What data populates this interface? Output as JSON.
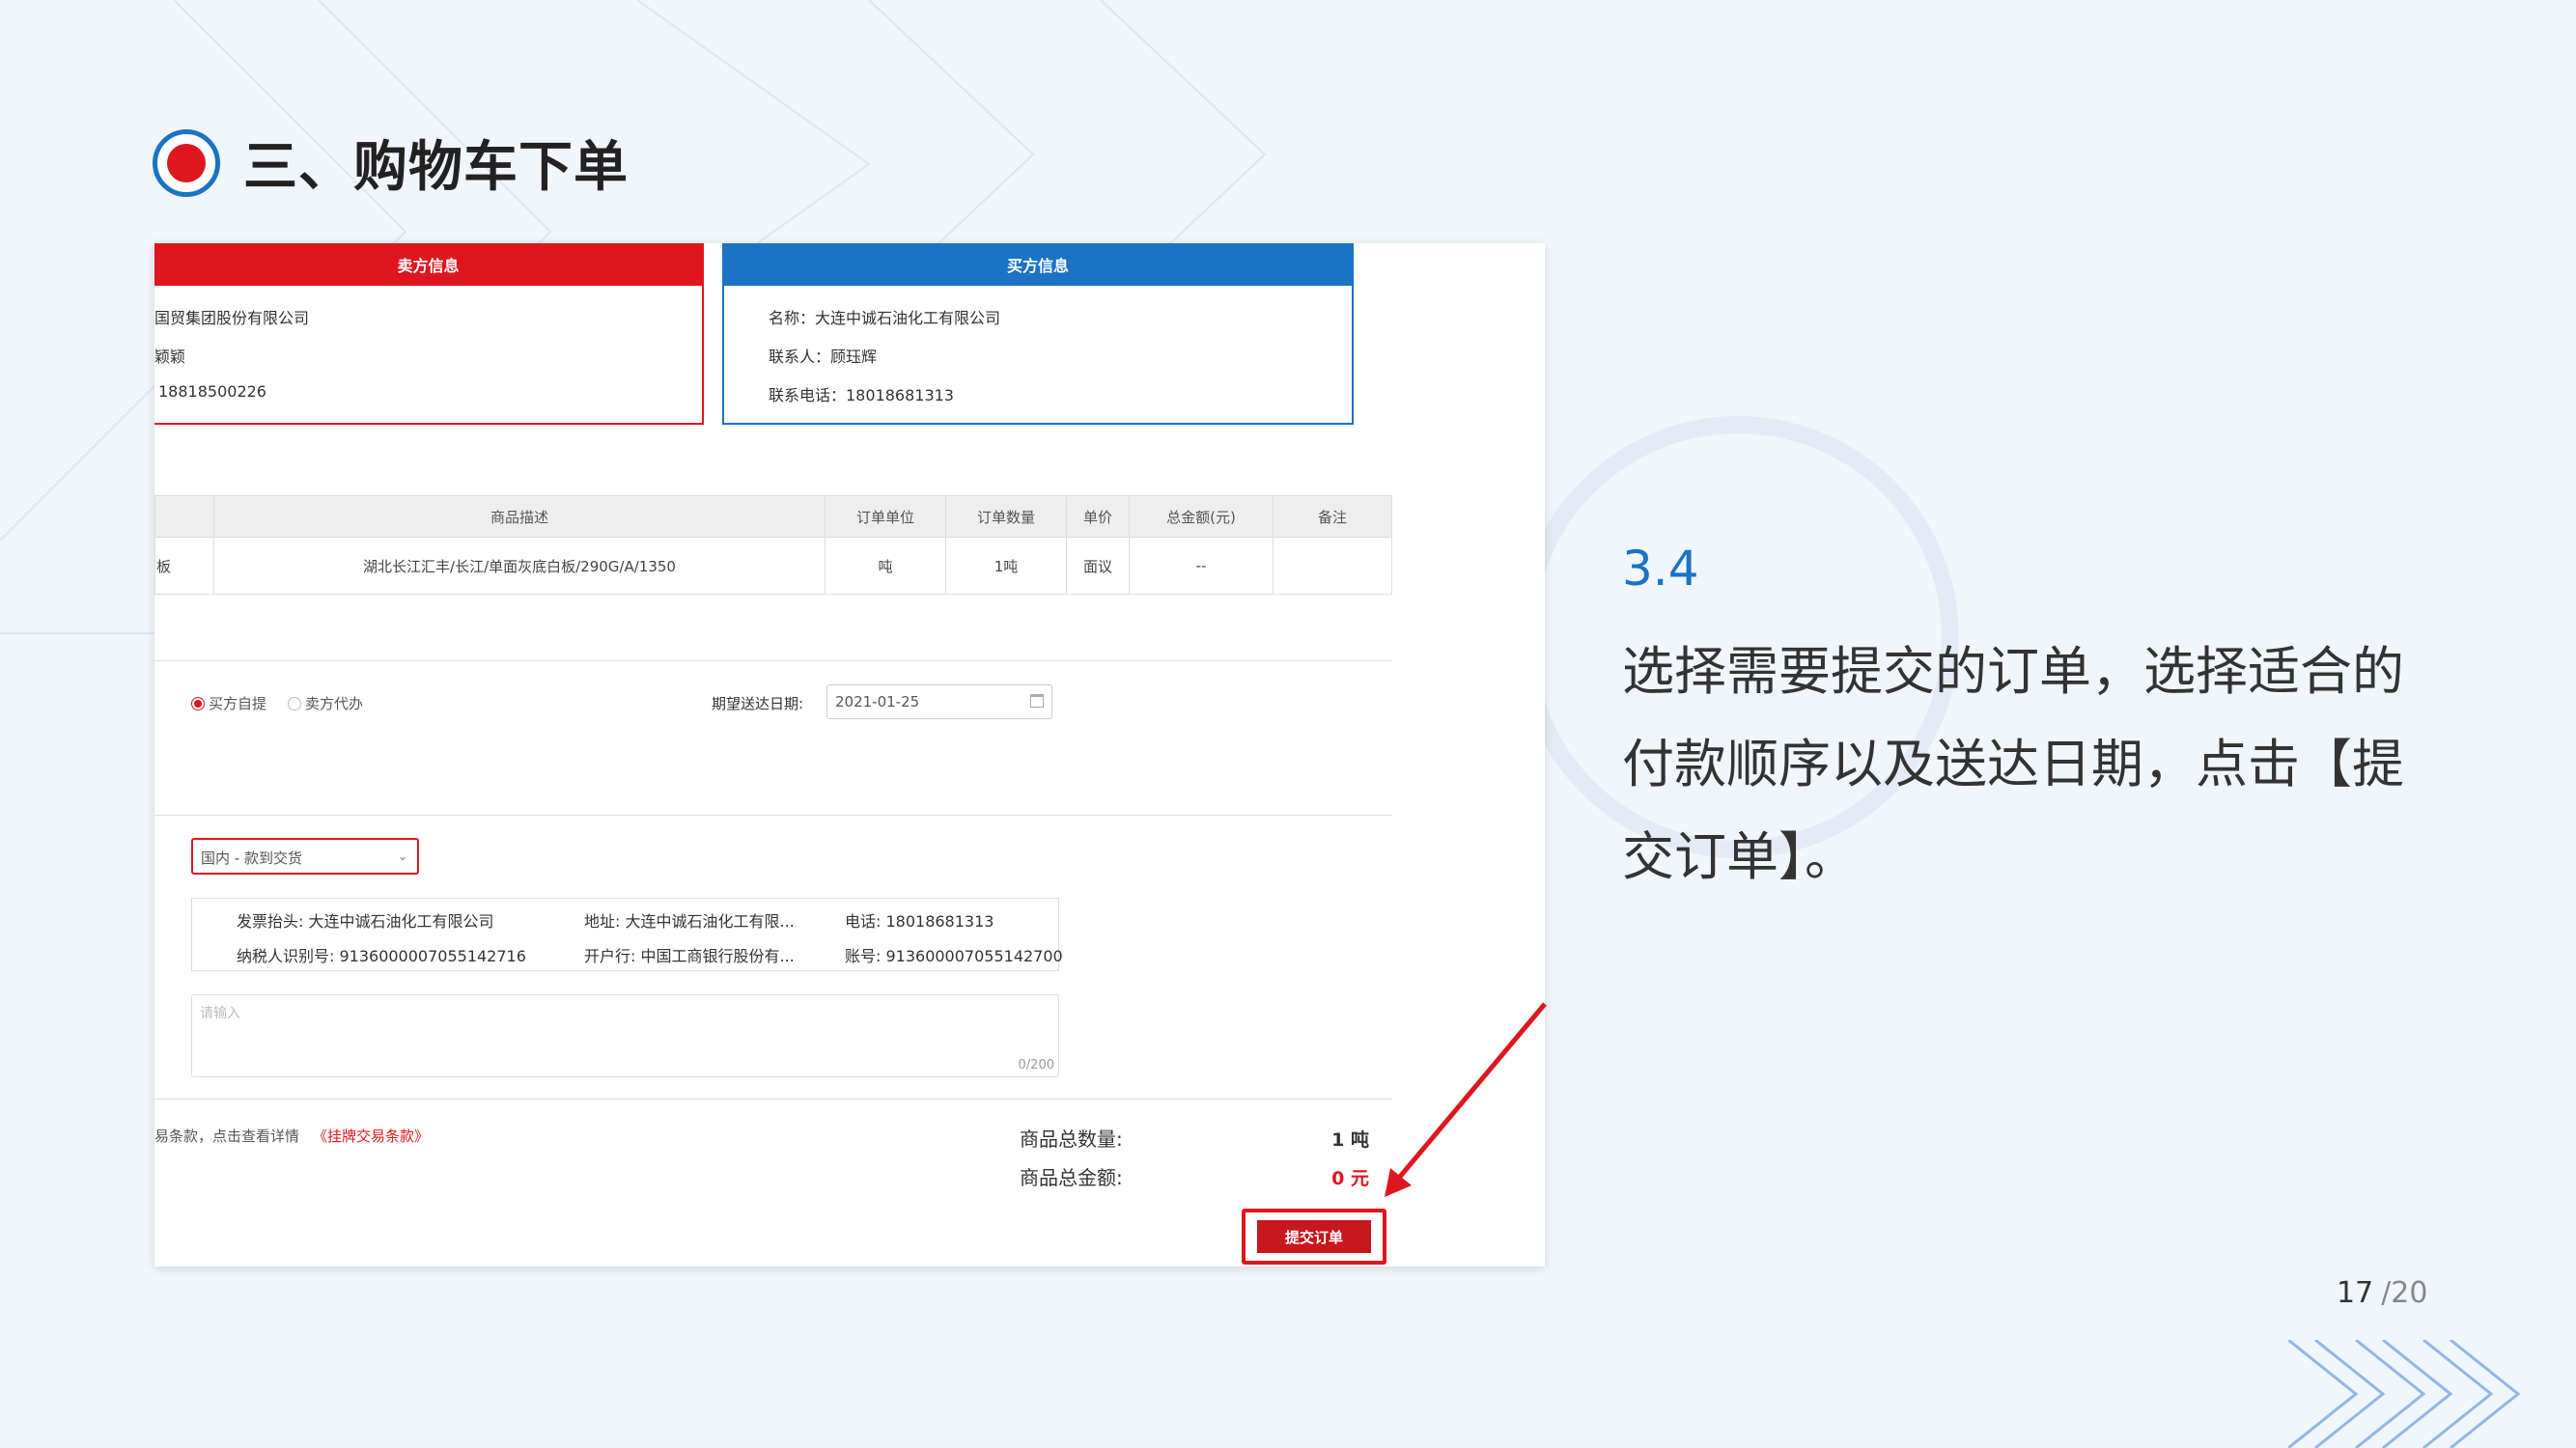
{
  "slide": {
    "title": "三、购物车下单",
    "step_number": "3.4",
    "description": "选择需要提交的订单，选择适合的付款顺序以及送达日期，点击【提交订单】。",
    "page_current": "17",
    "page_total": "/20"
  },
  "seller_card": {
    "header": "卖方信息",
    "name": "国贸集团股份有限公司",
    "contact": "颖颖",
    "phone": "18818500226"
  },
  "buyer_card": {
    "header": "买方信息",
    "name": "名称：大连中诚石油化工有限公司",
    "contact": "联系人：顾珏辉",
    "phone": "联系电话：18018681313"
  },
  "goods_table": {
    "headers": [
      "",
      "商品描述",
      "订单单位",
      "订单数量",
      "单价",
      "总金额(元)",
      "备注"
    ],
    "rows": [
      [
        "板",
        "湖北长江汇丰/长江/单面灰底白板/290G/A/1350",
        "吨",
        "1吨",
        "面议",
        "--",
        ""
      ]
    ]
  },
  "delivery": {
    "option_self": "买方自提",
    "option_seller": "卖方代办",
    "date_label": "期望送达日期:",
    "date_value": "2021-01-25"
  },
  "payment": {
    "selected": "国内 - 款到交货"
  },
  "invoice": {
    "title": "发票抬头: 大连中诚石油化工有限公司",
    "address": "地址: 大连中诚石油化工有限...",
    "phone": "电话: 18018681313",
    "tax_id": "纳税人识别号: 91360000070551427​16",
    "bank": "开户行: 中国工商银行股份有...",
    "account": "账号: 9136000070551427​00"
  },
  "remark": {
    "placeholder": "请输入",
    "counter": "0/200"
  },
  "terms": {
    "text": "易条款，点击查看详情",
    "link": "《挂牌交易条款》"
  },
  "summary": {
    "qty_label": "商品总数量:",
    "qty_value": "1 吨",
    "amount_label": "商品总金额:",
    "amount_value": "0 元"
  },
  "submit_button": "提交订单",
  "colors": {
    "red": "#e0161e",
    "blue": "#1a73c4"
  }
}
